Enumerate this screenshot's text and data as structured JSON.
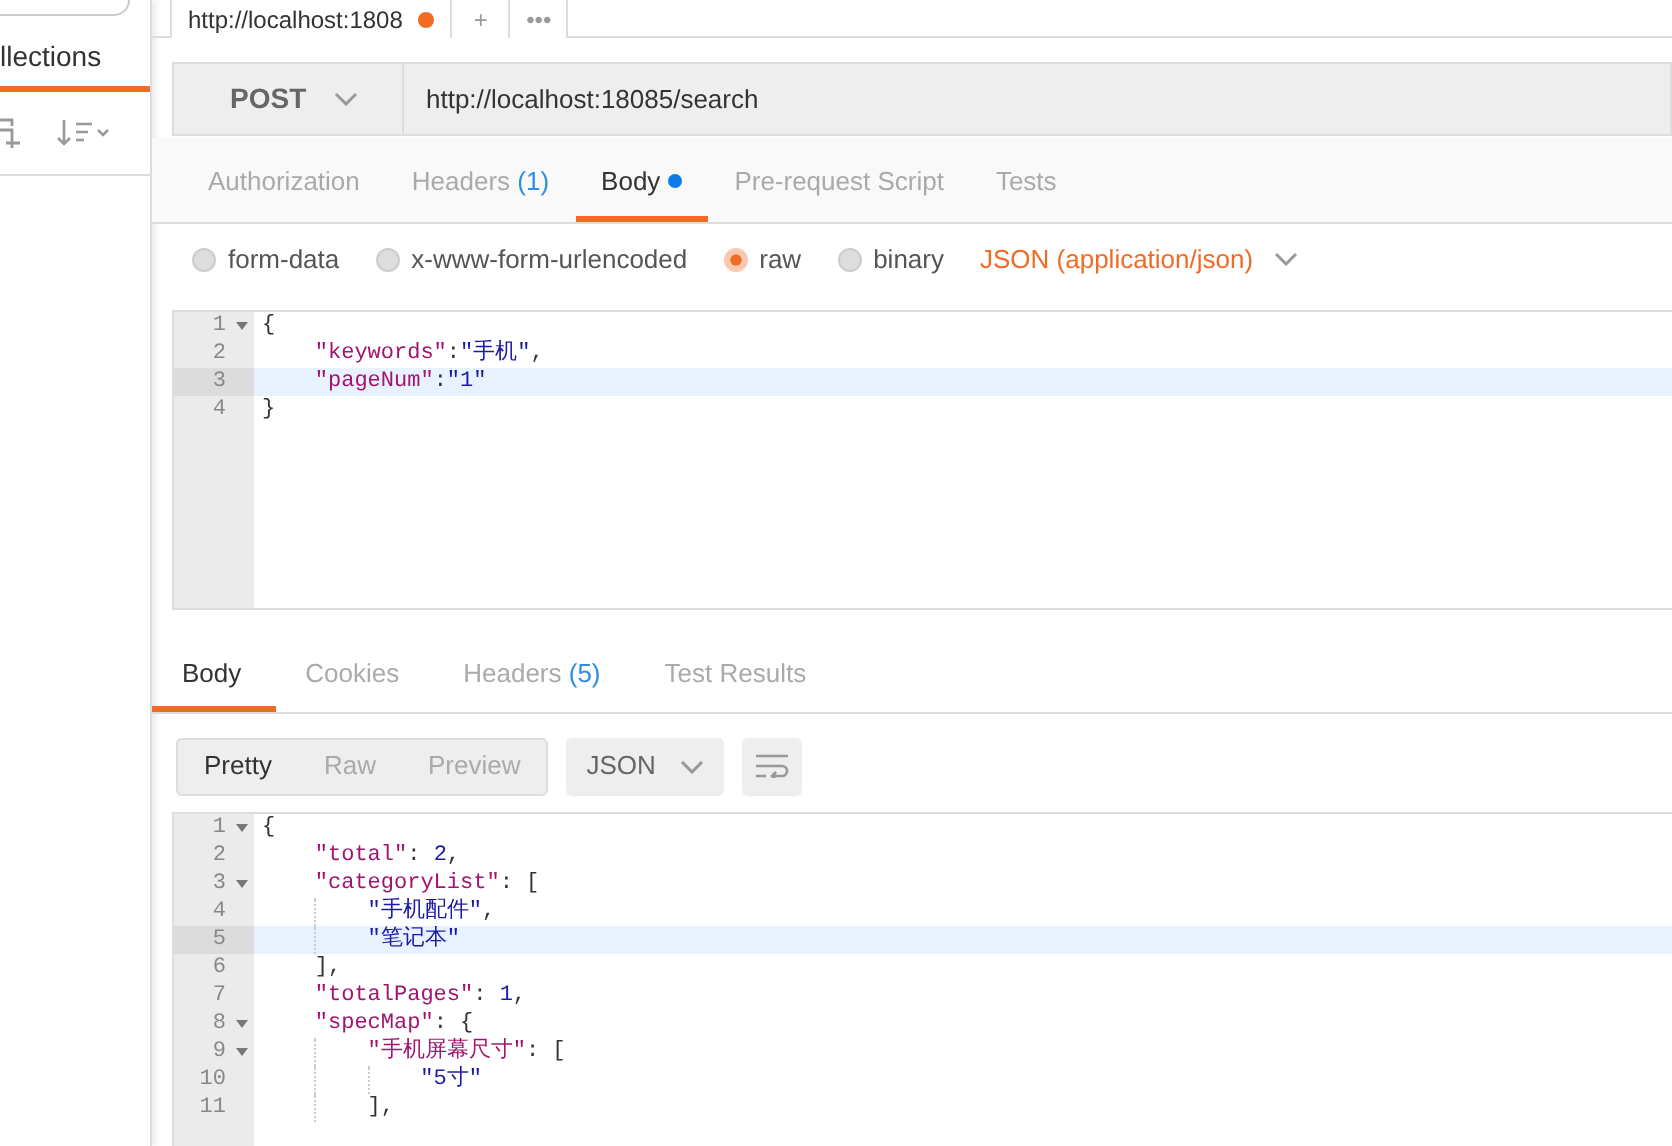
{
  "sidebar": {
    "tab": {
      "label": "llections",
      "selected": true
    }
  },
  "open_tabs": [
    {
      "kind": "request",
      "label": "http://localhost:1808",
      "unsaved": true
    },
    {
      "kind": "action",
      "label": "+"
    },
    {
      "kind": "action",
      "label": "•••"
    }
  ],
  "request": {
    "method": "POST",
    "url": "http://localhost:18085/search"
  },
  "request_tabs": [
    {
      "label": "Authorization",
      "selected": false,
      "modified": false
    },
    {
      "label": "Headers",
      "selected": false,
      "count": "(1)",
      "modified": false
    },
    {
      "label": "Body",
      "selected": true,
      "modified": true
    },
    {
      "label": "Pre-request Script",
      "selected": false,
      "modified": false
    },
    {
      "label": "Tests",
      "selected": false,
      "modified": false
    }
  ],
  "body_modes": [
    {
      "label": "form-data",
      "selected": false
    },
    {
      "label": "x-www-form-urlencoded",
      "selected": false
    },
    {
      "label": "raw",
      "selected": true
    },
    {
      "label": "binary",
      "selected": false
    }
  ],
  "content_type": "JSON (application/json)",
  "request_body": {
    "lines": [
      {
        "n": "1",
        "fold": true,
        "active": false,
        "tokens": [
          {
            "kind": "punct",
            "s": "{"
          }
        ]
      },
      {
        "n": "2",
        "fold": false,
        "active": false,
        "tokens": [
          {
            "kind": "key",
            "s": "\"keywords\""
          },
          {
            "kind": "punct",
            "s": ":"
          },
          {
            "kind": "str",
            "s": "\"手机\""
          },
          {
            "kind": "punct",
            "s": ","
          }
        ]
      },
      {
        "n": "3",
        "fold": false,
        "active": true,
        "tokens": [
          {
            "kind": "key",
            "s": "\"pageNum\""
          },
          {
            "kind": "punct",
            "s": ":"
          },
          {
            "kind": "str",
            "s": "\"1\""
          }
        ]
      },
      {
        "n": "4",
        "fold": false,
        "active": false,
        "tokens": [
          {
            "kind": "punct",
            "s": "}"
          }
        ]
      }
    ]
  },
  "response_tabs": [
    {
      "label": "Body",
      "selected": true
    },
    {
      "label": "Cookies",
      "selected": false
    },
    {
      "label": "Headers",
      "selected": false,
      "count": "(5)"
    },
    {
      "label": "Test Results",
      "selected": false
    }
  ],
  "response_view": {
    "modes": [
      {
        "label": "Pretty",
        "selected": true
      },
      {
        "label": "Raw",
        "selected": false
      },
      {
        "label": "Preview",
        "selected": false
      }
    ],
    "format": "JSON"
  },
  "response_body": {
    "lines": [
      {
        "n": "1",
        "fold": true,
        "active": false,
        "tokens": [
          {
            "kind": "punct",
            "s": "{"
          }
        ]
      },
      {
        "n": "2",
        "fold": false,
        "active": false,
        "tokens": [
          {
            "kind": "key",
            "s": "\"total\""
          },
          {
            "kind": "punct",
            "s": ": "
          },
          {
            "kind": "num",
            "s": "2"
          },
          {
            "kind": "punct",
            "s": ","
          }
        ]
      },
      {
        "n": "3",
        "fold": true,
        "active": false,
        "tokens": [
          {
            "kind": "key",
            "s": "\"categoryList\""
          },
          {
            "kind": "punct",
            "s": ": ["
          }
        ]
      },
      {
        "n": "4",
        "fold": false,
        "active": false,
        "tokens": [
          {
            "kind": "str",
            "s": "\"手机配件\""
          },
          {
            "kind": "punct",
            "s": ","
          }
        ]
      },
      {
        "n": "5",
        "fold": false,
        "active": true,
        "tokens": [
          {
            "kind": "str",
            "s": "\"笔记本\""
          }
        ]
      },
      {
        "n": "6",
        "fold": false,
        "active": false,
        "tokens": [
          {
            "kind": "punct",
            "s": "],"
          }
        ]
      },
      {
        "n": "7",
        "fold": false,
        "active": false,
        "tokens": [
          {
            "kind": "key",
            "s": "\"totalPages\""
          },
          {
            "kind": "punct",
            "s": ": "
          },
          {
            "kind": "num",
            "s": "1"
          },
          {
            "kind": "punct",
            "s": ","
          }
        ]
      },
      {
        "n": "8",
        "fold": true,
        "active": false,
        "tokens": [
          {
            "kind": "key",
            "s": "\"specMap\""
          },
          {
            "kind": "punct",
            "s": ": {"
          }
        ]
      },
      {
        "n": "9",
        "fold": true,
        "active": false,
        "tokens": [
          {
            "kind": "key",
            "s": "\"手机屏幕尺寸\""
          },
          {
            "kind": "punct",
            "s": ": ["
          }
        ]
      },
      {
        "n": "10",
        "fold": false,
        "active": false,
        "tokens": [
          {
            "kind": "str",
            "s": "\"5寸\""
          }
        ]
      },
      {
        "n": "11",
        "fold": false,
        "active": false,
        "tokens": [
          {
            "kind": "punct",
            "s": "],"
          }
        ]
      }
    ]
  }
}
